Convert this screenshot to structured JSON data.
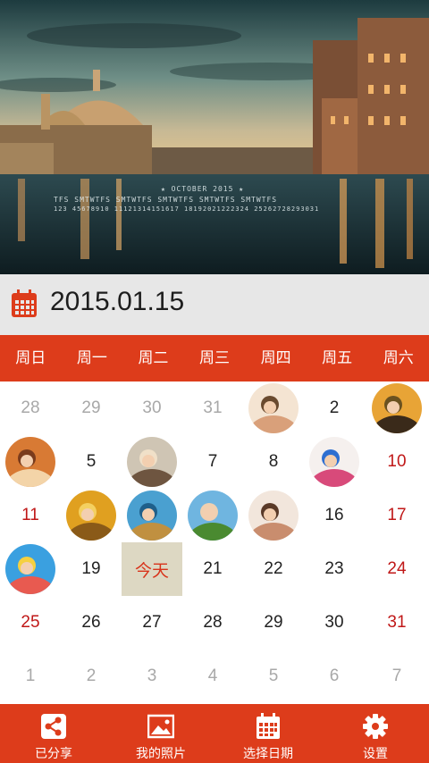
{
  "header": {
    "overlay_month": "★  OCTOBER   2015  ★",
    "overlay_days": "TFS   SMTWTFS   SMTWTFS   SMTWTFS   SMTWTFS   SMTWTFS",
    "overlay_nums": "123  45678910  11121314151617  18192021222324  25262728293031"
  },
  "date_bar": {
    "icon": "calendar-icon",
    "date": "2015.01.15"
  },
  "weekdays": [
    "周日",
    "周一",
    "周二",
    "周三",
    "周四",
    "周五",
    "周六"
  ],
  "calendar": {
    "today_label": "今天",
    "rows": [
      [
        {
          "t": "28",
          "s": "gray"
        },
        {
          "t": "29",
          "s": "gray"
        },
        {
          "t": "30",
          "s": "gray"
        },
        {
          "t": "31",
          "s": "gray"
        },
        {
          "photo": "girl-smiling"
        },
        {
          "t": "2",
          "s": "normal"
        },
        {
          "photo": "beach-sunset"
        }
      ],
      [
        {
          "photo": "mother-reading"
        },
        {
          "t": "5",
          "s": "normal"
        },
        {
          "photo": "family-group"
        },
        {
          "t": "7",
          "s": "normal"
        },
        {
          "t": "8",
          "s": "normal"
        },
        {
          "photo": "kids-playing"
        },
        {
          "t": "10",
          "s": "red"
        }
      ],
      [
        {
          "t": "11",
          "s": "red"
        },
        {
          "photo": "autumn-forest"
        },
        {
          "photo": "sea-sky"
        },
        {
          "photo": "family-outdoor"
        },
        {
          "photo": "mother-child"
        },
        {
          "t": "16",
          "s": "normal"
        },
        {
          "t": "17",
          "s": "red"
        }
      ],
      [
        {
          "photo": "kids-flowers"
        },
        {
          "t": "19",
          "s": "normal"
        },
        {
          "today": true
        },
        {
          "t": "21",
          "s": "normal"
        },
        {
          "t": "22",
          "s": "normal"
        },
        {
          "t": "23",
          "s": "normal"
        },
        {
          "t": "24",
          "s": "red"
        }
      ],
      [
        {
          "t": "25",
          "s": "red"
        },
        {
          "t": "26",
          "s": "normal"
        },
        {
          "t": "27",
          "s": "normal"
        },
        {
          "t": "28",
          "s": "normal"
        },
        {
          "t": "29",
          "s": "normal"
        },
        {
          "t": "30",
          "s": "normal"
        },
        {
          "t": "31",
          "s": "red"
        }
      ],
      [
        {
          "t": "1",
          "s": "gray"
        },
        {
          "t": "2",
          "s": "gray"
        },
        {
          "t": "3",
          "s": "gray"
        },
        {
          "t": "4",
          "s": "gray"
        },
        {
          "t": "5",
          "s": "gray"
        },
        {
          "t": "6",
          "s": "gray"
        },
        {
          "t": "7",
          "s": "gray"
        }
      ]
    ]
  },
  "bottom_nav": [
    {
      "label": "已分享",
      "icon": "share-icon"
    },
    {
      "label": "我的照片",
      "icon": "photo-icon"
    },
    {
      "label": "选择日期",
      "icon": "calendar-icon"
    },
    {
      "label": "设置",
      "icon": "gear-icon"
    }
  ],
  "colors": {
    "accent": "#dd3c1b",
    "weekend_red": "#c01818",
    "gray_text": "#a8a8a8",
    "today_bg": "#ddd8c3",
    "date_bar_bg": "#e7e7e7"
  }
}
